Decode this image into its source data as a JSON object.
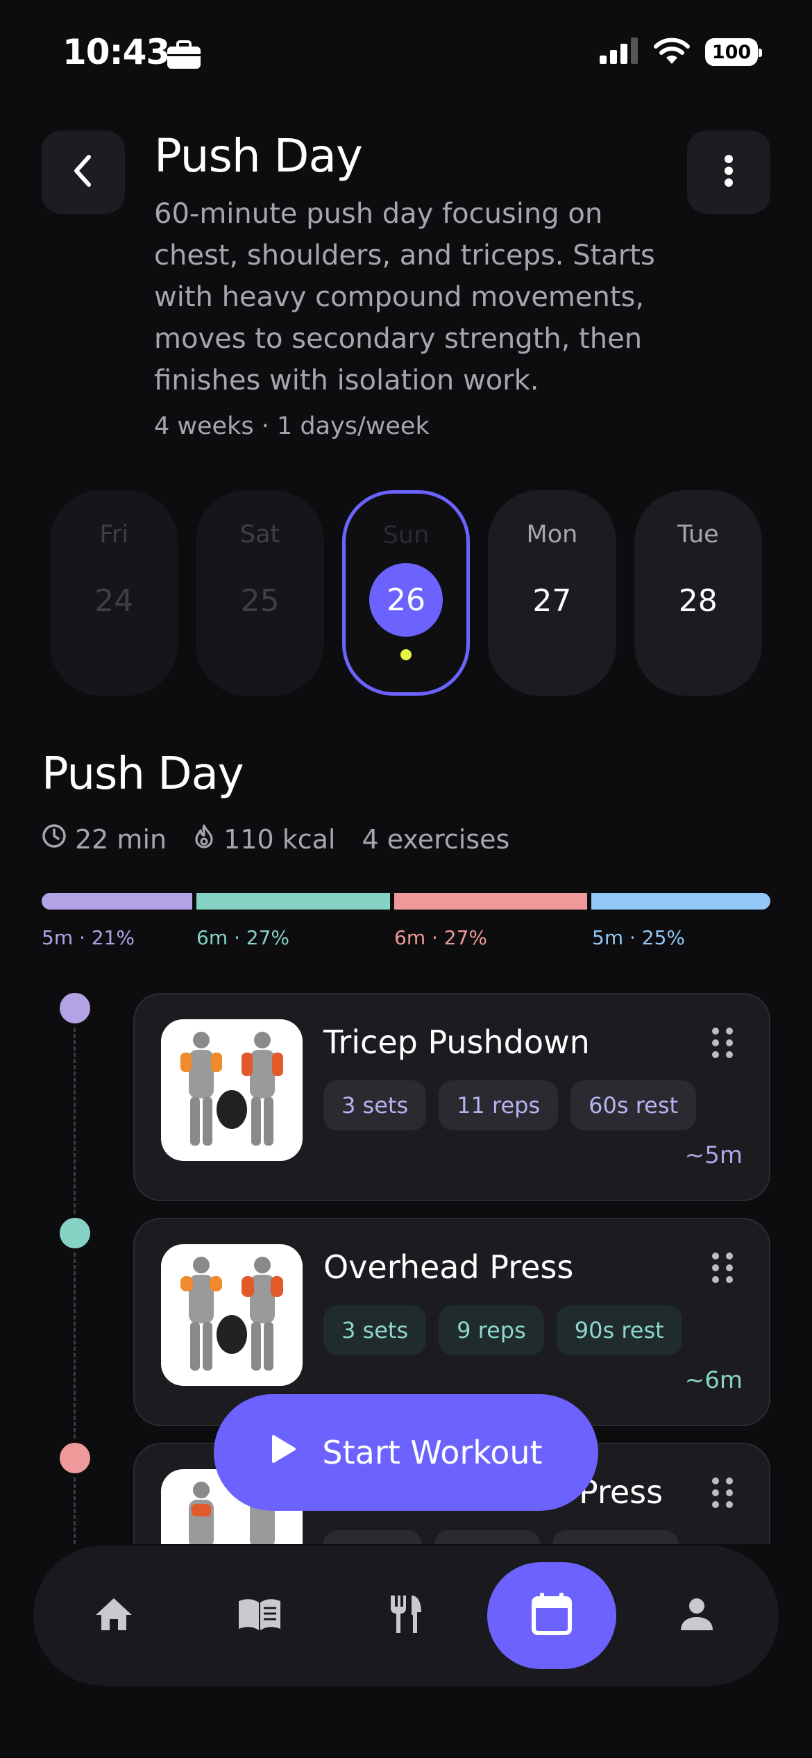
{
  "status_bar": {
    "time": "10:43",
    "battery": "100"
  },
  "header": {
    "title": "Push Day",
    "description": "60-minute push day focusing on chest, shoulders, and triceps. Starts with heavy compound movements, moves to secondary strength, then finishes with isolation work.",
    "meta": "4 weeks · 1 days/week"
  },
  "days": [
    {
      "name": "Fri",
      "num": "24"
    },
    {
      "name": "Sat",
      "num": "25"
    },
    {
      "name": "Sun",
      "num": "26"
    },
    {
      "name": "Mon",
      "num": "27"
    },
    {
      "name": "Tue",
      "num": "28"
    }
  ],
  "section": {
    "title": "Push Day",
    "duration": "22 min",
    "calories": "110 kcal",
    "exercises": "4 exercises"
  },
  "distribution": [
    {
      "label": "5m · 21%",
      "fraction": 0.21,
      "color": "#b3a2e6"
    },
    {
      "label": "6m · 27%",
      "fraction": 0.27,
      "color": "#86d3c6"
    },
    {
      "label": "6m · 27%",
      "fraction": 0.27,
      "color": "#ee9a9a"
    },
    {
      "label": "5m · 25%",
      "fraction": 0.25,
      "color": "#91c8f5"
    }
  ],
  "exercises": [
    {
      "name": "Tricep Pushdown",
      "sets": "3 sets",
      "reps": "11 reps",
      "rest": "60s rest",
      "estimate": "~5m"
    },
    {
      "name": "Overhead Press",
      "sets": "3 sets",
      "reps": "9 reps",
      "rest": "90s rest",
      "estimate": "~6m"
    },
    {
      "name": "Press"
    }
  ],
  "start_button": {
    "label": "Start Workout"
  },
  "nav": [
    "home-icon",
    "book-icon",
    "restaurant-icon",
    "calendar-icon",
    "person-icon"
  ]
}
